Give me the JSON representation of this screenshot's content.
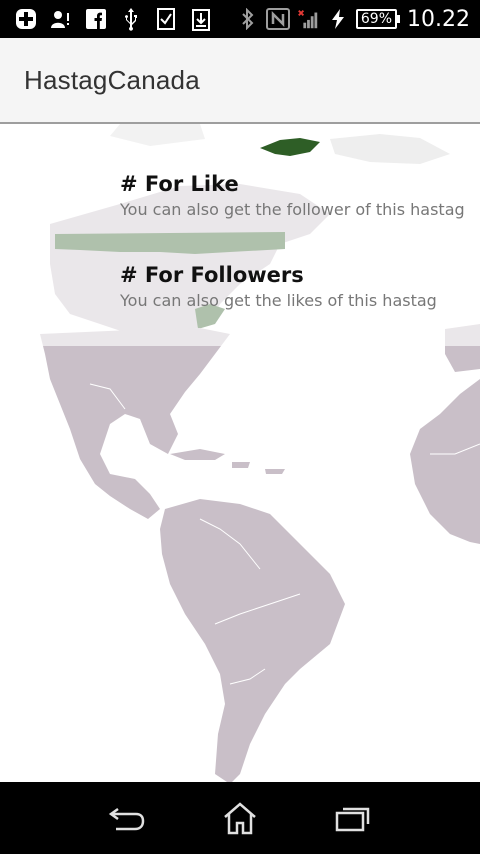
{
  "status_bar": {
    "battery": "69%",
    "time": "10.22",
    "icons": [
      "add-box-icon",
      "person-alert-icon",
      "facebook-icon",
      "usb-icon",
      "checklist-icon",
      "download-icon",
      "bluetooth-icon",
      "nfc-icon",
      "signal-icon",
      "charging-icon",
      "battery-icon"
    ]
  },
  "app_bar": {
    "title": "HastagCanada"
  },
  "list": {
    "items": [
      {
        "title": "# For Like",
        "subtitle": "You can also get the follower of this hastag"
      },
      {
        "title": "# For Followers",
        "subtitle": "You can also get the likes of this hastag"
      }
    ]
  },
  "colors": {
    "land": "#c9bfc8",
    "highlight": "#2e5e26",
    "app_bar": "#f5f5f5",
    "system_bars": "#000000"
  },
  "nav_bar": {
    "icons": [
      "back-icon",
      "home-icon",
      "recent-apps-icon"
    ]
  }
}
